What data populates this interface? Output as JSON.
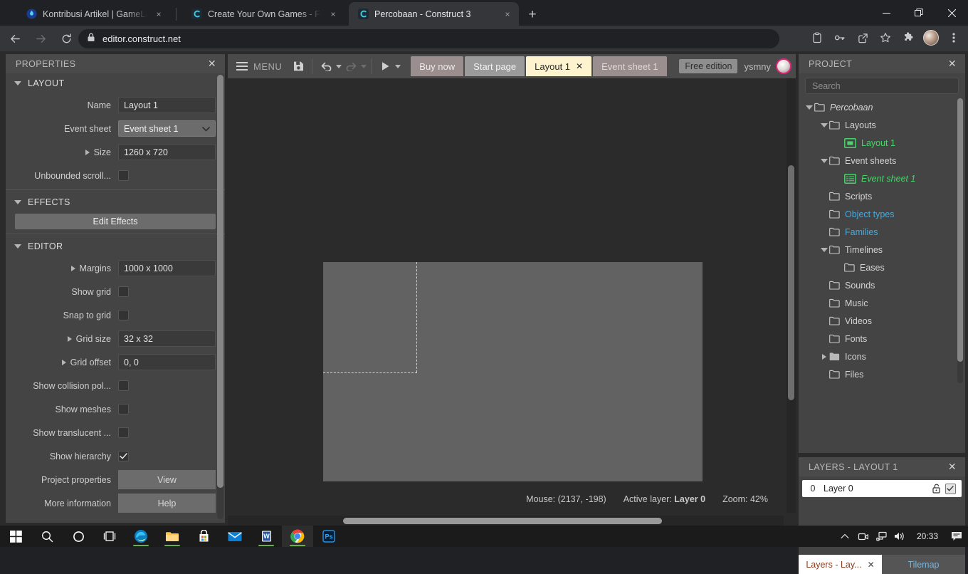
{
  "browser": {
    "tabs": [
      {
        "title": "Kontribusi Artikel | GameLab | Pla",
        "favicon": "gamelab-icon",
        "active": false,
        "close_label": "×"
      },
      {
        "title": "Create Your Own Games - Free T",
        "favicon": "construct-icon",
        "active": false,
        "close_label": "×"
      },
      {
        "title": "Percobaan - Construct 3",
        "favicon": "construct-icon",
        "active": true,
        "close_label": "×"
      }
    ],
    "new_tab_label": "+",
    "window_controls": {
      "minimize": "–",
      "maximize": "❐",
      "close": "✕"
    },
    "nav": {
      "back": "←",
      "forward": "→",
      "reload": "⟳"
    },
    "omnibox": {
      "url": "editor.construct.net",
      "lock_icon": "lock-icon"
    },
    "toolbar_icons": [
      "clipboard-icon",
      "key-icon",
      "share-icon",
      "star-icon",
      "puzzle-icon",
      "avatar",
      "menu-dots-icon"
    ]
  },
  "properties": {
    "header": "PROPERTIES",
    "close_label": "✕",
    "sections": [
      {
        "name": "LAYOUT",
        "rows": [
          {
            "label": "Name",
            "type": "text",
            "value": "Layout 1",
            "expandable": false
          },
          {
            "label": "Event sheet",
            "type": "select",
            "value": "Event sheet 1",
            "expandable": false
          },
          {
            "label": "Size",
            "type": "text",
            "value": "1260 x 720",
            "expandable": true
          },
          {
            "label": "Unbounded scroll...",
            "type": "checkbox",
            "checked": false,
            "expandable": false
          }
        ]
      },
      {
        "name": "EFFECTS",
        "button": "Edit Effects",
        "rows": []
      },
      {
        "name": "EDITOR",
        "rows": [
          {
            "label": "Margins",
            "type": "text",
            "value": "1000 x 1000",
            "expandable": true
          },
          {
            "label": "Show grid",
            "type": "checkbox",
            "checked": false,
            "expandable": false
          },
          {
            "label": "Snap to grid",
            "type": "checkbox",
            "checked": false,
            "expandable": false
          },
          {
            "label": "Grid size",
            "type": "text",
            "value": "32 x 32",
            "expandable": true
          },
          {
            "label": "Grid offset",
            "type": "text",
            "value": "0, 0",
            "expandable": true
          },
          {
            "label": "Show collision pol...",
            "type": "checkbox",
            "checked": false,
            "expandable": false
          },
          {
            "label": "Show meshes",
            "type": "checkbox",
            "checked": false,
            "expandable": false
          },
          {
            "label": "Show translucent ...",
            "type": "checkbox",
            "checked": false,
            "expandable": false
          },
          {
            "label": "Show hierarchy",
            "type": "checkbox",
            "checked": true,
            "expandable": false
          },
          {
            "label": "Project properties",
            "type": "link",
            "value": "View",
            "expandable": false
          },
          {
            "label": "More information",
            "type": "link",
            "value": "Help",
            "expandable": false
          }
        ]
      }
    ]
  },
  "editor_toolbar": {
    "menu_label": "MENU",
    "icons": [
      "save-icon",
      "undo-icon",
      "redo-icon",
      "preview-icon"
    ],
    "tabs": [
      {
        "label": "Buy now",
        "style": "buy",
        "closeable": false
      },
      {
        "label": "Start page",
        "style": "plain",
        "closeable": false
      },
      {
        "label": "Layout 1",
        "style": "active",
        "closeable": true,
        "close_label": "✕"
      },
      {
        "label": "Event sheet 1",
        "style": "dim",
        "closeable": false
      }
    ],
    "edition_badge": "Free edition",
    "username": "ysmny"
  },
  "status_bar": {
    "mouse": "Mouse: (2137, -198)",
    "active_layer_label": "Active layer:",
    "active_layer_value": "Layer 0",
    "zoom": "Zoom: 42%"
  },
  "project": {
    "header": "PROJECT",
    "close_label": "✕",
    "search_placeholder": "Search",
    "tree": [
      {
        "label": "Percobaan",
        "depth": 0,
        "tri": "down",
        "icon": "folder-icon",
        "color": "#d3d3d3",
        "italic": true
      },
      {
        "label": "Layouts",
        "depth": 1,
        "tri": "down",
        "icon": "folder-icon",
        "color": "#d3d3d3",
        "italic": false
      },
      {
        "label": "Layout 1",
        "depth": 2,
        "tri": "none",
        "icon": "layout-icon",
        "color": "#4ad26b",
        "italic": false
      },
      {
        "label": "Event sheets",
        "depth": 1,
        "tri": "down",
        "icon": "folder-icon",
        "color": "#d3d3d3",
        "italic": false
      },
      {
        "label": "Event sheet 1",
        "depth": 2,
        "tri": "none",
        "icon": "eventsheet-icon",
        "color": "#4ad26b",
        "italic": true
      },
      {
        "label": "Scripts",
        "depth": 1,
        "tri": "none",
        "icon": "folder-icon",
        "color": "#d3d3d3",
        "italic": false
      },
      {
        "label": "Object types",
        "depth": 1,
        "tri": "none",
        "icon": "folder-icon",
        "color": "#4aa8d8",
        "italic": false
      },
      {
        "label": "Families",
        "depth": 1,
        "tri": "none",
        "icon": "folder-icon",
        "color": "#4aa8d8",
        "italic": false
      },
      {
        "label": "Timelines",
        "depth": 1,
        "tri": "down",
        "icon": "folder-icon",
        "color": "#d3d3d3",
        "italic": false
      },
      {
        "label": "Eases",
        "depth": 2,
        "tri": "none",
        "icon": "folder-icon",
        "color": "#d3d3d3",
        "italic": false
      },
      {
        "label": "Sounds",
        "depth": 1,
        "tri": "none",
        "icon": "folder-icon",
        "color": "#d3d3d3",
        "italic": false
      },
      {
        "label": "Music",
        "depth": 1,
        "tri": "none",
        "icon": "folder-icon",
        "color": "#d3d3d3",
        "italic": false
      },
      {
        "label": "Videos",
        "depth": 1,
        "tri": "none",
        "icon": "folder-icon",
        "color": "#d3d3d3",
        "italic": false
      },
      {
        "label": "Fonts",
        "depth": 1,
        "tri": "none",
        "icon": "folder-icon",
        "color": "#d3d3d3",
        "italic": false
      },
      {
        "label": "Icons",
        "depth": 1,
        "tri": "right",
        "icon": "folder-filled-icon",
        "color": "#d3d3d3",
        "italic": false
      },
      {
        "label": "Files",
        "depth": 1,
        "tri": "none",
        "icon": "folder-icon",
        "color": "#d3d3d3",
        "italic": false
      }
    ]
  },
  "layers": {
    "header": "LAYERS - LAYOUT 1",
    "close_label": "✕",
    "rows": [
      {
        "index": "0",
        "name": "Layer 0",
        "locked": false,
        "visible": true
      }
    ],
    "dock_tabs": [
      {
        "label": "Layers - Lay...",
        "active": true,
        "close_label": "✕"
      },
      {
        "label": "Tilemap",
        "active": false,
        "close_label": ""
      }
    ]
  },
  "taskbar": {
    "items": [
      {
        "name": "start-button",
        "running": false
      },
      {
        "name": "search-icon",
        "running": false
      },
      {
        "name": "cortana-icon",
        "running": false
      },
      {
        "name": "task-view-icon",
        "running": false
      },
      {
        "name": "edge-icon",
        "running": true
      },
      {
        "name": "file-explorer-icon",
        "running": true
      },
      {
        "name": "microsoft-store-icon",
        "running": false
      },
      {
        "name": "mail-icon",
        "running": false
      },
      {
        "name": "word-icon",
        "running": true
      },
      {
        "name": "chrome-icon",
        "running": true
      },
      {
        "name": "photoshop-icon",
        "running": false
      }
    ],
    "tray": {
      "chevron": "∧",
      "icons": [
        "screen-record-icon",
        "network-icon",
        "volume-icon"
      ],
      "clock": "20:33",
      "action_center": "notification-icon"
    }
  },
  "colors": {
    "accent_green": "#4ad26b",
    "accent_blue": "#4aa8d8",
    "active_tab_bg": "#fdf3cf",
    "panel_bg": "#444444",
    "canvas_bg": "#2b2b2b",
    "layout_fill": "#626262"
  }
}
